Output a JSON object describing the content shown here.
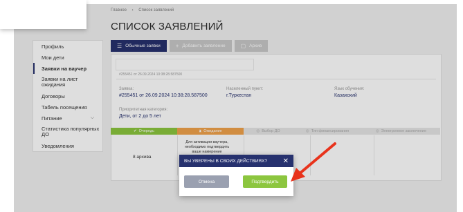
{
  "breadcrumb": [
    "Главное",
    "›",
    "Список заявлений"
  ],
  "page_title": "СПИСОК ЗАЯВЛЕНИЙ",
  "sidebar": {
    "items": [
      {
        "label": "Профиль"
      },
      {
        "label": "Мои дети"
      },
      {
        "label": "Заявки на ваучер"
      },
      {
        "label": "Заявки на лист ожидания"
      },
      {
        "label": "Договоры"
      },
      {
        "label": "Табель посещения"
      },
      {
        "label": "Питание"
      },
      {
        "label": "Статистика популярных ДО"
      },
      {
        "label": "Уведомления"
      }
    ]
  },
  "tabs": [
    {
      "label": "Обычные заявки",
      "icon": "list-icon"
    },
    {
      "label": "Добавить заявление",
      "icon": "plus-icon"
    },
    {
      "label": "Архив",
      "icon": "file-icon"
    }
  ],
  "request": {
    "small_id": "#255451 от 26.09.2024 10:38:28.587500",
    "app_label": "Заявка:",
    "app_value": "#255451 от 26.09.2024 10:38:28.587500",
    "city_label": "Населенный пункт:",
    "city_value": "г.Туркестан",
    "lang_label": "Язык обучения:",
    "lang_value": "Казахский",
    "cat_label": "Приоритетная категория:",
    "cat_value": "Дети, от 2 до 5 лет"
  },
  "statuses": [
    {
      "label": "Очередь",
      "icon": "check-icon"
    },
    {
      "label": "Ожидание",
      "icon": "hourglass-icon"
    },
    {
      "label": "Выбор ДО",
      "icon": "circle-icon"
    },
    {
      "label": "Тип финансирования",
      "icon": "circle-icon"
    },
    {
      "label": "Электронное заключение",
      "icon": "circle-icon"
    }
  ],
  "row": {
    "archive": "8 архива",
    "note": "Для активации ваучера, необходимо подтвердить ваше намерение"
  },
  "modal": {
    "title": "ВЫ УВЕРЕНЫ В СВОИХ ДЕЙСТВИЯХ?",
    "cancel": "Отмена",
    "confirm": "Подтвердить"
  },
  "colors": {
    "primary": "#26316e",
    "green": "#8cc63f",
    "orange": "#f0a24b",
    "arrow": "#e8331c"
  }
}
